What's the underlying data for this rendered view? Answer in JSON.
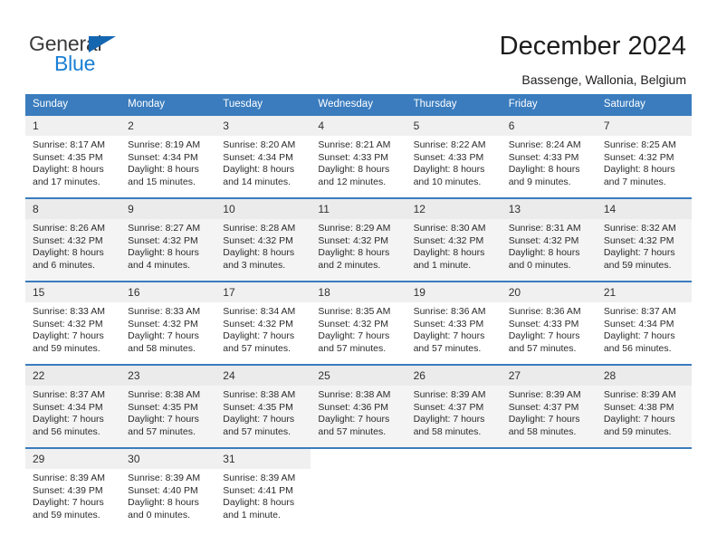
{
  "brand": {
    "name_part1": "General",
    "name_part2": "Blue",
    "triangle_icon": "triangle-icon",
    "color_dark": "#3b3b3b",
    "color_blue": "#1a7fd4"
  },
  "header": {
    "title": "December 2024",
    "subtitle": "Bassenge, Wallonia, Belgium"
  },
  "calendar": {
    "header_bg": "#3a7cbe",
    "header_text_color": "#ffffff",
    "weekdays": [
      "Sunday",
      "Monday",
      "Tuesday",
      "Wednesday",
      "Thursday",
      "Friday",
      "Saturday"
    ],
    "weeks": [
      {
        "shaded": false,
        "days": [
          {
            "date": "1",
            "sunrise": "Sunrise: 8:17 AM",
            "sunset": "Sunset: 4:35 PM",
            "daylight_1": "Daylight: 8 hours",
            "daylight_2": "and 17 minutes."
          },
          {
            "date": "2",
            "sunrise": "Sunrise: 8:19 AM",
            "sunset": "Sunset: 4:34 PM",
            "daylight_1": "Daylight: 8 hours",
            "daylight_2": "and 15 minutes."
          },
          {
            "date": "3",
            "sunrise": "Sunrise: 8:20 AM",
            "sunset": "Sunset: 4:34 PM",
            "daylight_1": "Daylight: 8 hours",
            "daylight_2": "and 14 minutes."
          },
          {
            "date": "4",
            "sunrise": "Sunrise: 8:21 AM",
            "sunset": "Sunset: 4:33 PM",
            "daylight_1": "Daylight: 8 hours",
            "daylight_2": "and 12 minutes."
          },
          {
            "date": "5",
            "sunrise": "Sunrise: 8:22 AM",
            "sunset": "Sunset: 4:33 PM",
            "daylight_1": "Daylight: 8 hours",
            "daylight_2": "and 10 minutes."
          },
          {
            "date": "6",
            "sunrise": "Sunrise: 8:24 AM",
            "sunset": "Sunset: 4:33 PM",
            "daylight_1": "Daylight: 8 hours",
            "daylight_2": "and 9 minutes."
          },
          {
            "date": "7",
            "sunrise": "Sunrise: 8:25 AM",
            "sunset": "Sunset: 4:32 PM",
            "daylight_1": "Daylight: 8 hours",
            "daylight_2": "and 7 minutes."
          }
        ]
      },
      {
        "shaded": true,
        "days": [
          {
            "date": "8",
            "sunrise": "Sunrise: 8:26 AM",
            "sunset": "Sunset: 4:32 PM",
            "daylight_1": "Daylight: 8 hours",
            "daylight_2": "and 6 minutes."
          },
          {
            "date": "9",
            "sunrise": "Sunrise: 8:27 AM",
            "sunset": "Sunset: 4:32 PM",
            "daylight_1": "Daylight: 8 hours",
            "daylight_2": "and 4 minutes."
          },
          {
            "date": "10",
            "sunrise": "Sunrise: 8:28 AM",
            "sunset": "Sunset: 4:32 PM",
            "daylight_1": "Daylight: 8 hours",
            "daylight_2": "and 3 minutes."
          },
          {
            "date": "11",
            "sunrise": "Sunrise: 8:29 AM",
            "sunset": "Sunset: 4:32 PM",
            "daylight_1": "Daylight: 8 hours",
            "daylight_2": "and 2 minutes."
          },
          {
            "date": "12",
            "sunrise": "Sunrise: 8:30 AM",
            "sunset": "Sunset: 4:32 PM",
            "daylight_1": "Daylight: 8 hours",
            "daylight_2": "and 1 minute."
          },
          {
            "date": "13",
            "sunrise": "Sunrise: 8:31 AM",
            "sunset": "Sunset: 4:32 PM",
            "daylight_1": "Daylight: 8 hours",
            "daylight_2": "and 0 minutes."
          },
          {
            "date": "14",
            "sunrise": "Sunrise: 8:32 AM",
            "sunset": "Sunset: 4:32 PM",
            "daylight_1": "Daylight: 7 hours",
            "daylight_2": "and 59 minutes."
          }
        ]
      },
      {
        "shaded": false,
        "days": [
          {
            "date": "15",
            "sunrise": "Sunrise: 8:33 AM",
            "sunset": "Sunset: 4:32 PM",
            "daylight_1": "Daylight: 7 hours",
            "daylight_2": "and 59 minutes."
          },
          {
            "date": "16",
            "sunrise": "Sunrise: 8:33 AM",
            "sunset": "Sunset: 4:32 PM",
            "daylight_1": "Daylight: 7 hours",
            "daylight_2": "and 58 minutes."
          },
          {
            "date": "17",
            "sunrise": "Sunrise: 8:34 AM",
            "sunset": "Sunset: 4:32 PM",
            "daylight_1": "Daylight: 7 hours",
            "daylight_2": "and 57 minutes."
          },
          {
            "date": "18",
            "sunrise": "Sunrise: 8:35 AM",
            "sunset": "Sunset: 4:32 PM",
            "daylight_1": "Daylight: 7 hours",
            "daylight_2": "and 57 minutes."
          },
          {
            "date": "19",
            "sunrise": "Sunrise: 8:36 AM",
            "sunset": "Sunset: 4:33 PM",
            "daylight_1": "Daylight: 7 hours",
            "daylight_2": "and 57 minutes."
          },
          {
            "date": "20",
            "sunrise": "Sunrise: 8:36 AM",
            "sunset": "Sunset: 4:33 PM",
            "daylight_1": "Daylight: 7 hours",
            "daylight_2": "and 57 minutes."
          },
          {
            "date": "21",
            "sunrise": "Sunrise: 8:37 AM",
            "sunset": "Sunset: 4:34 PM",
            "daylight_1": "Daylight: 7 hours",
            "daylight_2": "and 56 minutes."
          }
        ]
      },
      {
        "shaded": true,
        "days": [
          {
            "date": "22",
            "sunrise": "Sunrise: 8:37 AM",
            "sunset": "Sunset: 4:34 PM",
            "daylight_1": "Daylight: 7 hours",
            "daylight_2": "and 56 minutes."
          },
          {
            "date": "23",
            "sunrise": "Sunrise: 8:38 AM",
            "sunset": "Sunset: 4:35 PM",
            "daylight_1": "Daylight: 7 hours",
            "daylight_2": "and 57 minutes."
          },
          {
            "date": "24",
            "sunrise": "Sunrise: 8:38 AM",
            "sunset": "Sunset: 4:35 PM",
            "daylight_1": "Daylight: 7 hours",
            "daylight_2": "and 57 minutes."
          },
          {
            "date": "25",
            "sunrise": "Sunrise: 8:38 AM",
            "sunset": "Sunset: 4:36 PM",
            "daylight_1": "Daylight: 7 hours",
            "daylight_2": "and 57 minutes."
          },
          {
            "date": "26",
            "sunrise": "Sunrise: 8:39 AM",
            "sunset": "Sunset: 4:37 PM",
            "daylight_1": "Daylight: 7 hours",
            "daylight_2": "and 58 minutes."
          },
          {
            "date": "27",
            "sunrise": "Sunrise: 8:39 AM",
            "sunset": "Sunset: 4:37 PM",
            "daylight_1": "Daylight: 7 hours",
            "daylight_2": "and 58 minutes."
          },
          {
            "date": "28",
            "sunrise": "Sunrise: 8:39 AM",
            "sunset": "Sunset: 4:38 PM",
            "daylight_1": "Daylight: 7 hours",
            "daylight_2": "and 59 minutes."
          }
        ]
      },
      {
        "shaded": false,
        "days": [
          {
            "date": "29",
            "sunrise": "Sunrise: 8:39 AM",
            "sunset": "Sunset: 4:39 PM",
            "daylight_1": "Daylight: 7 hours",
            "daylight_2": "and 59 minutes."
          },
          {
            "date": "30",
            "sunrise": "Sunrise: 8:39 AM",
            "sunset": "Sunset: 4:40 PM",
            "daylight_1": "Daylight: 8 hours",
            "daylight_2": "and 0 minutes."
          },
          {
            "date": "31",
            "sunrise": "Sunrise: 8:39 AM",
            "sunset": "Sunset: 4:41 PM",
            "daylight_1": "Daylight: 8 hours",
            "daylight_2": "and 1 minute."
          },
          {
            "date": "",
            "sunrise": "",
            "sunset": "",
            "daylight_1": "",
            "daylight_2": ""
          },
          {
            "date": "",
            "sunrise": "",
            "sunset": "",
            "daylight_1": "",
            "daylight_2": ""
          },
          {
            "date": "",
            "sunrise": "",
            "sunset": "",
            "daylight_1": "",
            "daylight_2": ""
          },
          {
            "date": "",
            "sunrise": "",
            "sunset": "",
            "daylight_1": "",
            "daylight_2": ""
          }
        ]
      }
    ]
  }
}
